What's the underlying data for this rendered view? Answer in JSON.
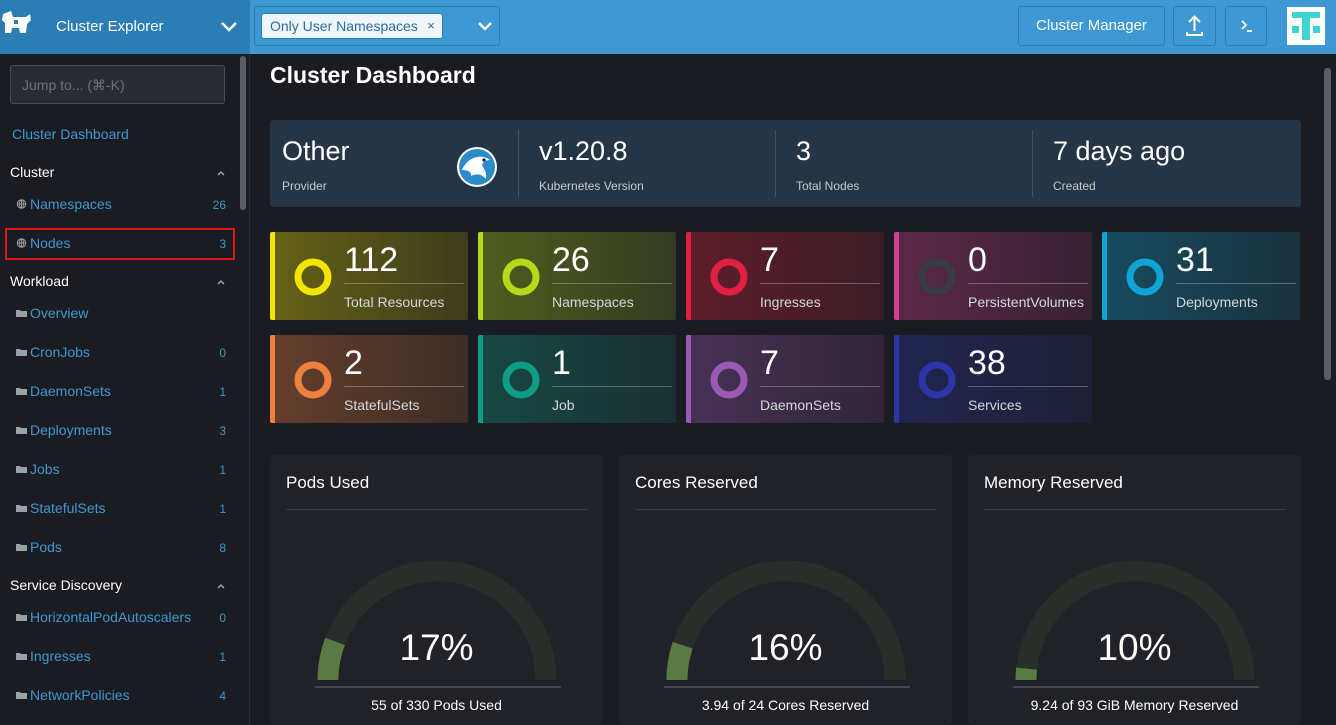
{
  "header": {
    "brand_title": "Cluster Explorer",
    "namespace_filter_chip": "Only User Namespaces",
    "namespace_filter_remove": "×",
    "cluster_manager_label": "Cluster Manager",
    "accent_color": "#3d98d3"
  },
  "sidebar": {
    "jump_placeholder": "Jump to... (⌘-K)",
    "dashboard_link": "Cluster Dashboard",
    "groups": {
      "cluster": "Cluster",
      "workload": "Workload",
      "service_discovery": "Service Discovery"
    },
    "cluster_items": [
      {
        "label": "Namespaces",
        "count": "26",
        "icon": "globe-icon"
      },
      {
        "label": "Nodes",
        "count": "3",
        "icon": "globe-icon"
      }
    ],
    "workload_items": [
      {
        "label": "Overview",
        "count": ""
      },
      {
        "label": "CronJobs",
        "count": "0"
      },
      {
        "label": "DaemonSets",
        "count": "1"
      },
      {
        "label": "Deployments",
        "count": "3"
      },
      {
        "label": "Jobs",
        "count": "1"
      },
      {
        "label": "StatefulSets",
        "count": "1"
      },
      {
        "label": "Pods",
        "count": "8"
      }
    ],
    "service_items": [
      {
        "label": "HorizontalPodAutoscalers",
        "count": "0"
      },
      {
        "label": "Ingresses",
        "count": "1"
      },
      {
        "label": "NetworkPolicies",
        "count": "4"
      }
    ]
  },
  "main": {
    "title": "Cluster Dashboard",
    "summary": [
      {
        "value": "Other",
        "label": "Provider"
      },
      {
        "value": "v1.20.8",
        "label": "Kubernetes Version"
      },
      {
        "value": "3",
        "label": "Total Nodes"
      },
      {
        "value": "7 days ago",
        "label": "Created"
      }
    ],
    "tiles": [
      {
        "value": "112",
        "label": "Total Resources",
        "color": "#f2e600"
      },
      {
        "value": "26",
        "label": "Namespaces",
        "color": "#b6d91a"
      },
      {
        "value": "7",
        "label": "Ingresses",
        "color": "#e02040"
      },
      {
        "value": "0",
        "label": "PersistentVolumes",
        "color": "#d43f8f"
      },
      {
        "value": "31",
        "label": "Deployments",
        "color": "#0ea5d6"
      },
      {
        "value": "2",
        "label": "StatefulSets",
        "color": "#f08040"
      },
      {
        "value": "1",
        "label": "Job",
        "color": "#0f9c84"
      },
      {
        "value": "7",
        "label": "DaemonSets",
        "color": "#9b59b6"
      },
      {
        "value": "38",
        "label": "Services",
        "color": "#2d35a8"
      }
    ],
    "gauges": [
      {
        "title": "Pods Used",
        "percent": "17%",
        "fraction": 0.17,
        "caption": "55 of 330 Pods Used"
      },
      {
        "title": "Cores Reserved",
        "percent": "16%",
        "fraction": 0.16,
        "caption": "3.94 of 24 Cores Reserved"
      },
      {
        "title": "Memory Reserved",
        "percent": "10%",
        "fraction": 0.1,
        "caption": "9.24 of 93 GiB Memory Reserved"
      }
    ]
  }
}
